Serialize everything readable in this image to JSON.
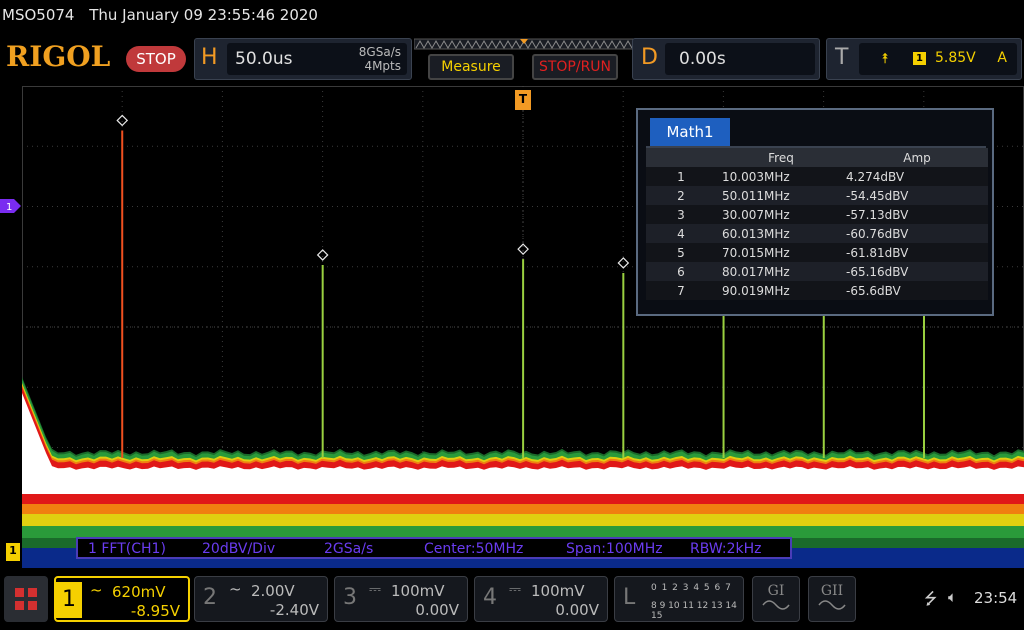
{
  "header": {
    "model": "MSO5074",
    "datetime": "Thu January 09 23:55:46 2020"
  },
  "logo": {
    "text": "RIGOL"
  },
  "run_state": {
    "label": "STOP"
  },
  "horizontal": {
    "letter": "H",
    "timebase": "50.0us",
    "sample_rate": "8GSa/s",
    "memory_depth": "4Mpts"
  },
  "buttons": {
    "measure": "Measure",
    "stop_run": "STOP/RUN"
  },
  "delay": {
    "letter": "D",
    "value": "0.00s"
  },
  "trigger": {
    "letter": "T",
    "source": "1",
    "level": "5.85V",
    "mode": "A"
  },
  "markers": {
    "trigger_pos": "T",
    "math_ref": "1",
    "ch1_ref": "1"
  },
  "math_table": {
    "tab": "Math1",
    "columns": [
      "Freq",
      "Amp"
    ],
    "rows": [
      {
        "index": "1",
        "freq": "10.003MHz",
        "amp": "4.274dBV"
      },
      {
        "index": "2",
        "freq": "50.011MHz",
        "amp": "-54.45dBV"
      },
      {
        "index": "3",
        "freq": "30.007MHz",
        "amp": "-57.13dBV"
      },
      {
        "index": "4",
        "freq": "60.013MHz",
        "amp": "-60.76dBV"
      },
      {
        "index": "5",
        "freq": "70.015MHz",
        "amp": "-61.81dBV"
      },
      {
        "index": "6",
        "freq": "80.017MHz",
        "amp": "-65.16dBV"
      },
      {
        "index": "7",
        "freq": "90.019MHz",
        "amp": "-65.6dBV"
      }
    ]
  },
  "fft_info": {
    "source": "1 FFT(CH1)",
    "scale": "20dBV/Div",
    "rate": "2GSa/s",
    "center": "Center:50MHz",
    "span": "Span:100MHz",
    "rbw": "RBW:2kHz"
  },
  "channels": [
    {
      "num": "1",
      "coupling": "~",
      "scale": "620mV",
      "offset": "-8.95V",
      "color": "#f5d000"
    },
    {
      "num": "2",
      "coupling": "~",
      "scale": "2.00V",
      "offset": "-2.40V",
      "color": "#bbbbbb"
    },
    {
      "num": "3",
      "coupling": "⎓",
      "scale": "100mV",
      "offset": "0.00V",
      "color": "#bbbbbb"
    },
    {
      "num": "4",
      "coupling": "⎓",
      "scale": "100mV",
      "offset": "0.00V",
      "color": "#bbbbbb"
    }
  ],
  "logic": {
    "letter": "L",
    "row1": "0 1 2 3  4 5 6 7",
    "row2": "8 9 10 11  12 13 14 15"
  },
  "gen_buttons": [
    "GI",
    "GII"
  ],
  "status": {
    "usb_icon": "usb-icon",
    "speaker_icon": "speaker-muted-icon",
    "time": "23:54"
  },
  "peaks_chart_data": {
    "type": "scatter",
    "x": [
      10.003,
      50.011,
      30.007,
      60.013,
      70.015,
      80.017,
      90.019
    ],
    "y": [
      4.274,
      -54.45,
      -57.13,
      -60.76,
      -61.81,
      -65.16,
      -65.6
    ],
    "xlim": [
      0,
      100
    ],
    "ylim": [
      -200,
      20
    ]
  }
}
